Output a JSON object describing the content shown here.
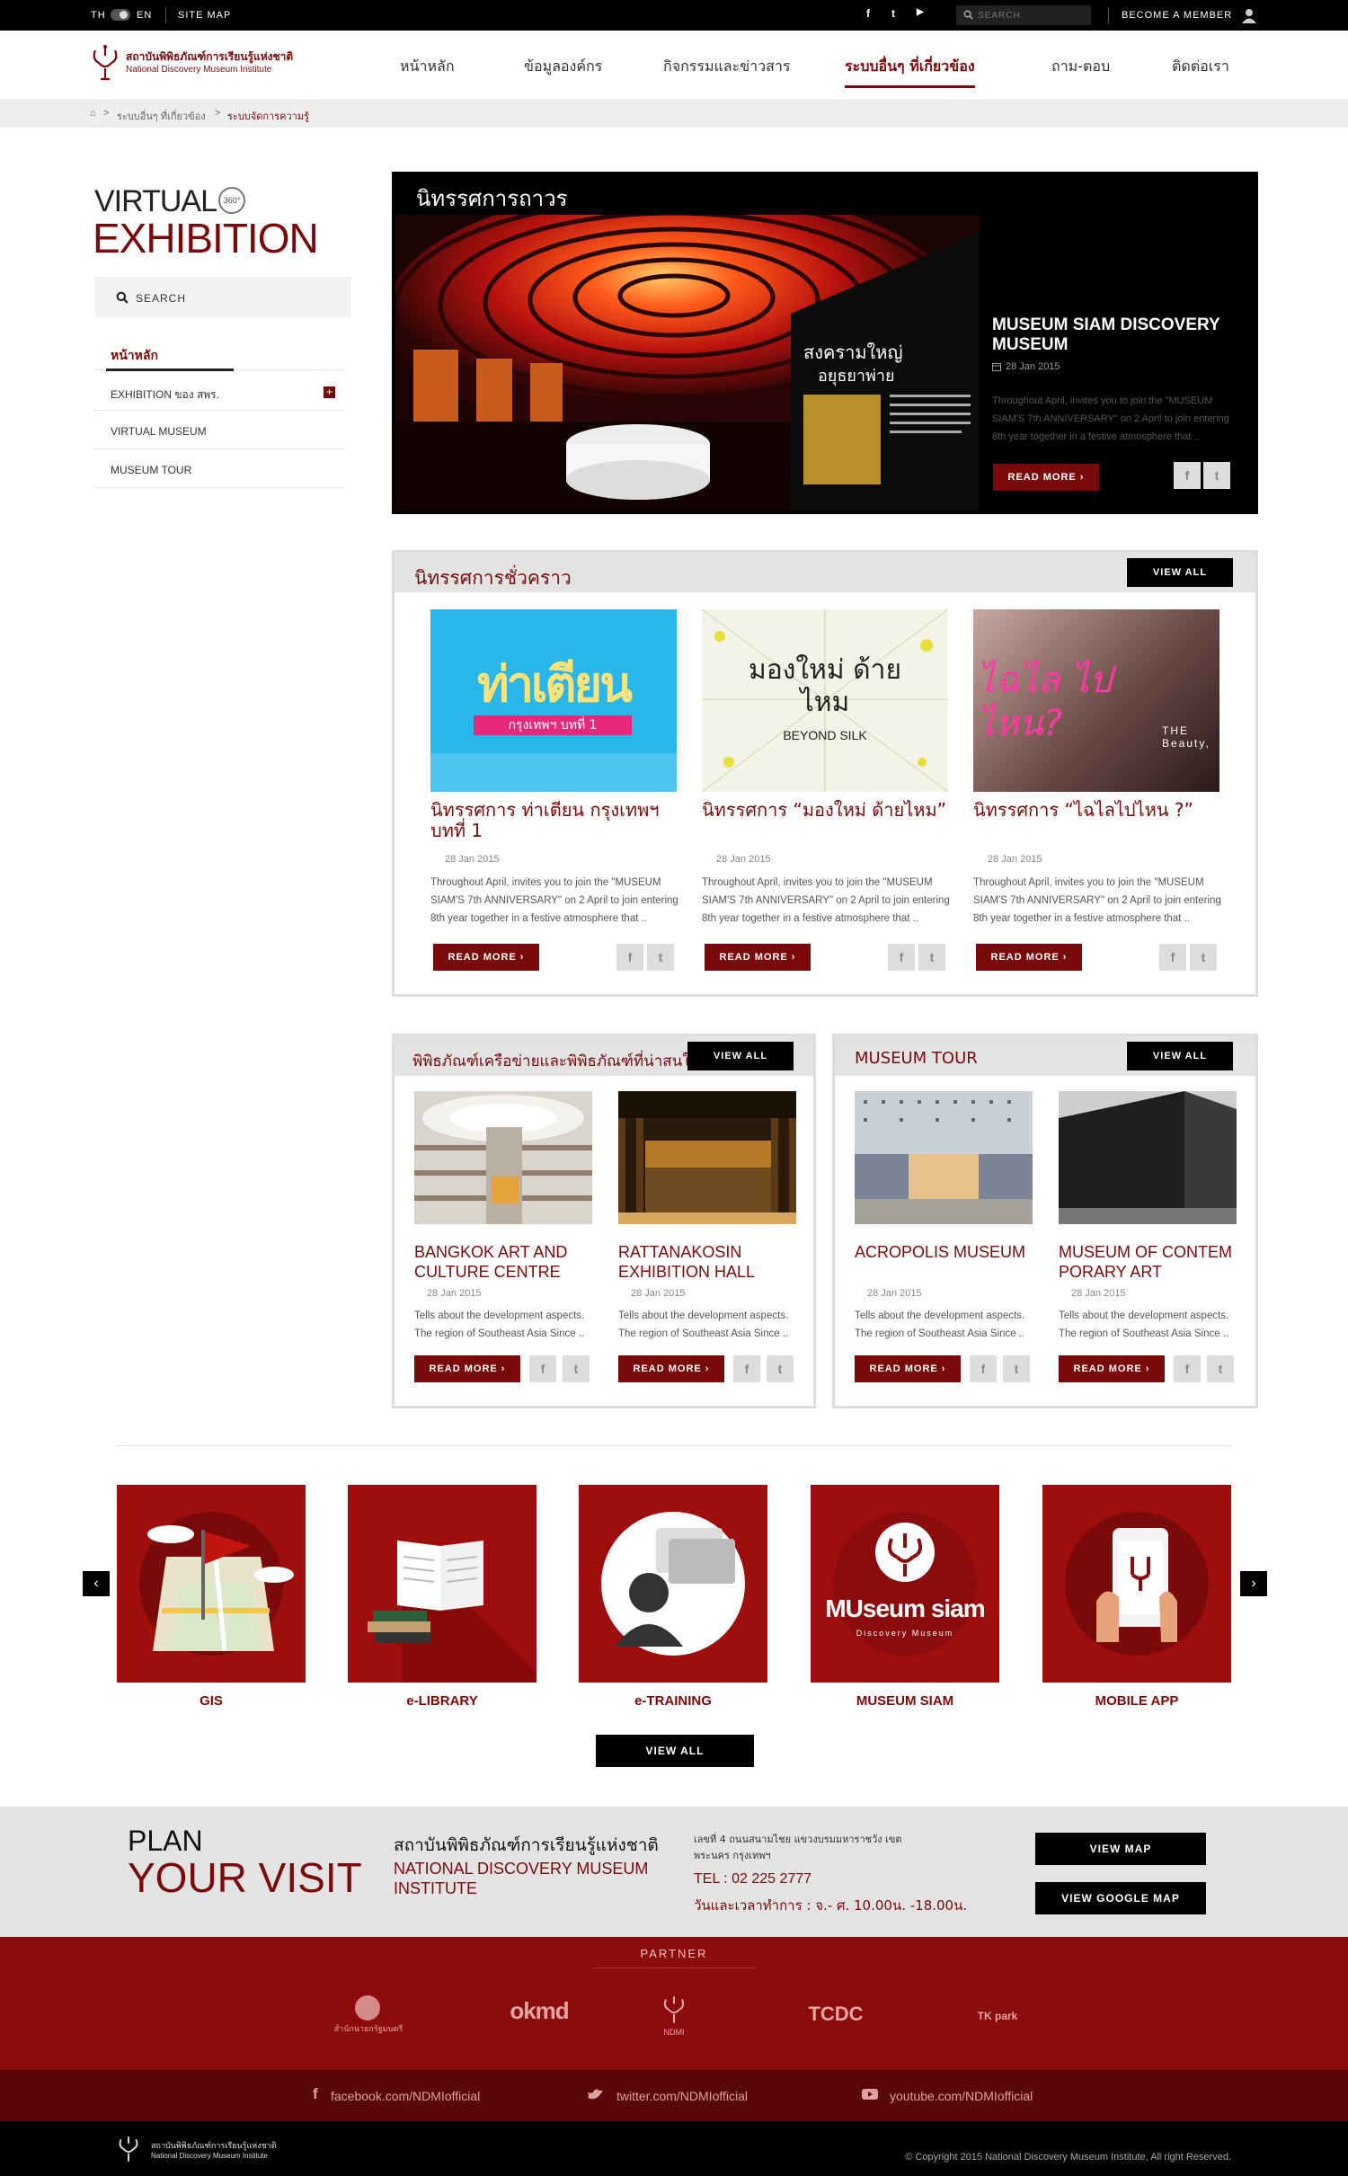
{
  "colors": {
    "brand": "#7a0a0a",
    "accent": "#9e0e0e",
    "bar": "#000000"
  },
  "topbar": {
    "lang_th": "TH",
    "lang_en": "EN",
    "sitemap": "SITE MAP",
    "social": [
      "f",
      "t",
      "▶"
    ],
    "search_placeholder": "SEARCH",
    "member": "BECOME A MEMBER"
  },
  "header": {
    "logo_th": "สถาบันพิพิธภัณฑ์การเรียนรู้แห่งชาติ",
    "logo_en": "National Discovery Museum Institute",
    "nav": [
      "หน้าหลัก",
      "ข้อมูลองค์กร",
      "กิจกรรมและข่าวสาร",
      "ระบบอื่นๆ ที่เกี่ยวข้อง",
      "ถาม-ตอบ",
      "ติดต่อเรา"
    ]
  },
  "breadcrumb": {
    "home": "⌂",
    "sep": ">",
    "level1": "ระบบอื่นๆ ที่เกี่ยวข้อง",
    "level2": "ระบบจัดการความรู้"
  },
  "sidebar": {
    "title1": "VIRTUAL",
    "badge": "360°",
    "title2": "EXHIBITION",
    "search": "SEARCH",
    "items": [
      {
        "label": "หน้าหลัก"
      },
      {
        "label": "EXHIBITION ของ สพร.",
        "toggle": "+"
      },
      {
        "label": "VIRTUAL MUSEUM"
      },
      {
        "label": "MUSEUM TOUR"
      }
    ]
  },
  "permanent": {
    "heading": "นิทรรศการถาวร",
    "title": "MUSEUM SIAM DISCOVERY MUSEUM",
    "date": "28 Jan 2015",
    "desc": "Throughout April, invites you to join the \"MUSEUM SIAM'S 7th ANNIVERSARY\" on 2 April to join entering 8th year together in a festive atmosphere that ..",
    "read_more": "READ MORE  ›",
    "sign_th": "สงครามใหญ่ อยุธยาพ่าย"
  },
  "temporary": {
    "heading": "นิทรรศการชั่วคราว",
    "view_all": "VIEW ALL",
    "cards": [
      {
        "title": "นิทรรศการ ท่าเตียน กรุงเทพฯ บทที่ 1",
        "img_text": "ท่าเตียน",
        "img_sub": "กรุงเทพฯ บทที่ 1",
        "date": "28 Jan 2015",
        "desc": "Throughout April, invites you to join the \"MUSEUM SIAM'S 7th ANNIVERSARY\" on 2 April to join entering 8th year together in a festive atmosphere that ..",
        "read_more": "READ MORE  ›"
      },
      {
        "title": "นิทรรศการ “มองใหม่ ด้ายไหม”",
        "img_text": "มองใหม่ ด้ายไหม",
        "img_sub": "BEYOND SILK",
        "date": "28 Jan 2015",
        "desc": "Throughout April, invites you to join the \"MUSEUM SIAM'S 7th ANNIVERSARY\" on 2 April to join entering 8th year together in a festive atmosphere that ..",
        "read_more": "READ MORE  ›"
      },
      {
        "title": "นิทรรศการ “ไฉไลไปไหน ?”",
        "img_text": "ไฉไล ไปไหน?",
        "img_sub": "THE Beauty,",
        "date": "28 Jan 2015",
        "desc": "Throughout April, invites you to join the \"MUSEUM SIAM'S 7th ANNIVERSARY\" on 2 April to join entering 8th year together in a festive atmosphere that ..",
        "read_more": "READ MORE  ›"
      }
    ]
  },
  "network": {
    "heading": "พิพิธภัณฑ์เครือข่ายและพิพิธภัณฑ์ที่น่าสนใจ",
    "view_all": "VIEW ALL",
    "cards": [
      {
        "title": "BANGKOK ART AND CULTURE CENTRE",
        "date": "28 Jan 2015",
        "desc": "Tells about the development aspects. The region of Southeast Asia Since ..",
        "read_more": "READ MORE  ›"
      },
      {
        "title": "RATTANAKOSIN EXHIBITION HALL",
        "date": "28 Jan 2015",
        "desc": "Tells about the development aspects. The region of Southeast Asia Since ..",
        "read_more": "READ MORE  ›"
      }
    ]
  },
  "tour": {
    "heading": "MUSEUM TOUR",
    "view_all": "VIEW ALL",
    "cards": [
      {
        "title": "ACROPOLIS MUSEUM",
        "date": "28 Jan 2015",
        "desc": "Tells about the development aspects. The region of Southeast Asia Since ..",
        "read_more": "READ MORE  ›"
      },
      {
        "title": "MUSEUM OF CONTEM PORARY ART",
        "date": "28 Jan 2015",
        "desc": "Tells about the development aspects. The region of Southeast Asia Since ..",
        "read_more": "READ MORE  ›"
      }
    ]
  },
  "services": {
    "items": [
      "GIS",
      "e-LIBRARY",
      "e-TRAINING",
      "MUSEUM SIAM",
      "MOBILE APP"
    ],
    "museum_logo": "MUseum siam",
    "museum_logo_sub": "Discovery Museum",
    "view_all": "VIEW ALL",
    "prev": "‹",
    "next": "›"
  },
  "visit": {
    "line1": "PLAN",
    "line2": "YOUR VISIT",
    "org_th": "สถาบันพิพิธภัณฑ์การเรียนรู้แห่งชาติ",
    "org_en": "NATIONAL DISCOVERY MUSEUM INSTITUTE",
    "address": "เลขที่ 4 ถนนสนามไชย แขวงบรมมหาราชวัง เขตพระนคร กรุงเทพฯ",
    "tel": "TEL : 02 225 2777",
    "hours": "วันและเวลาทำการ : จ.- ศ. 10.00น. -18.00น.",
    "view_map": "VIEW MAP",
    "view_google_map": "VIEW GOOGLE MAP"
  },
  "partner": {
    "heading": "PARTNER",
    "logos": [
      "สำนักนายกรัฐมนตรี",
      "okmd",
      "NDMI",
      "TCDC",
      "TK park"
    ]
  },
  "footer_social": {
    "facebook": "facebook.com/NDMIofficial",
    "twitter": "twitter.com/NDMIofficial",
    "youtube": "youtube.com/NDMIofficial"
  },
  "footer": {
    "logo_th": "สถาบันพิพิธภัณฑ์การเรียนรู้แห่งชาติ",
    "logo_en": "National Discovery Museum Institute",
    "copyright": "© Copyright 2015 National Discovery Museum Institute, All right Reserved."
  }
}
